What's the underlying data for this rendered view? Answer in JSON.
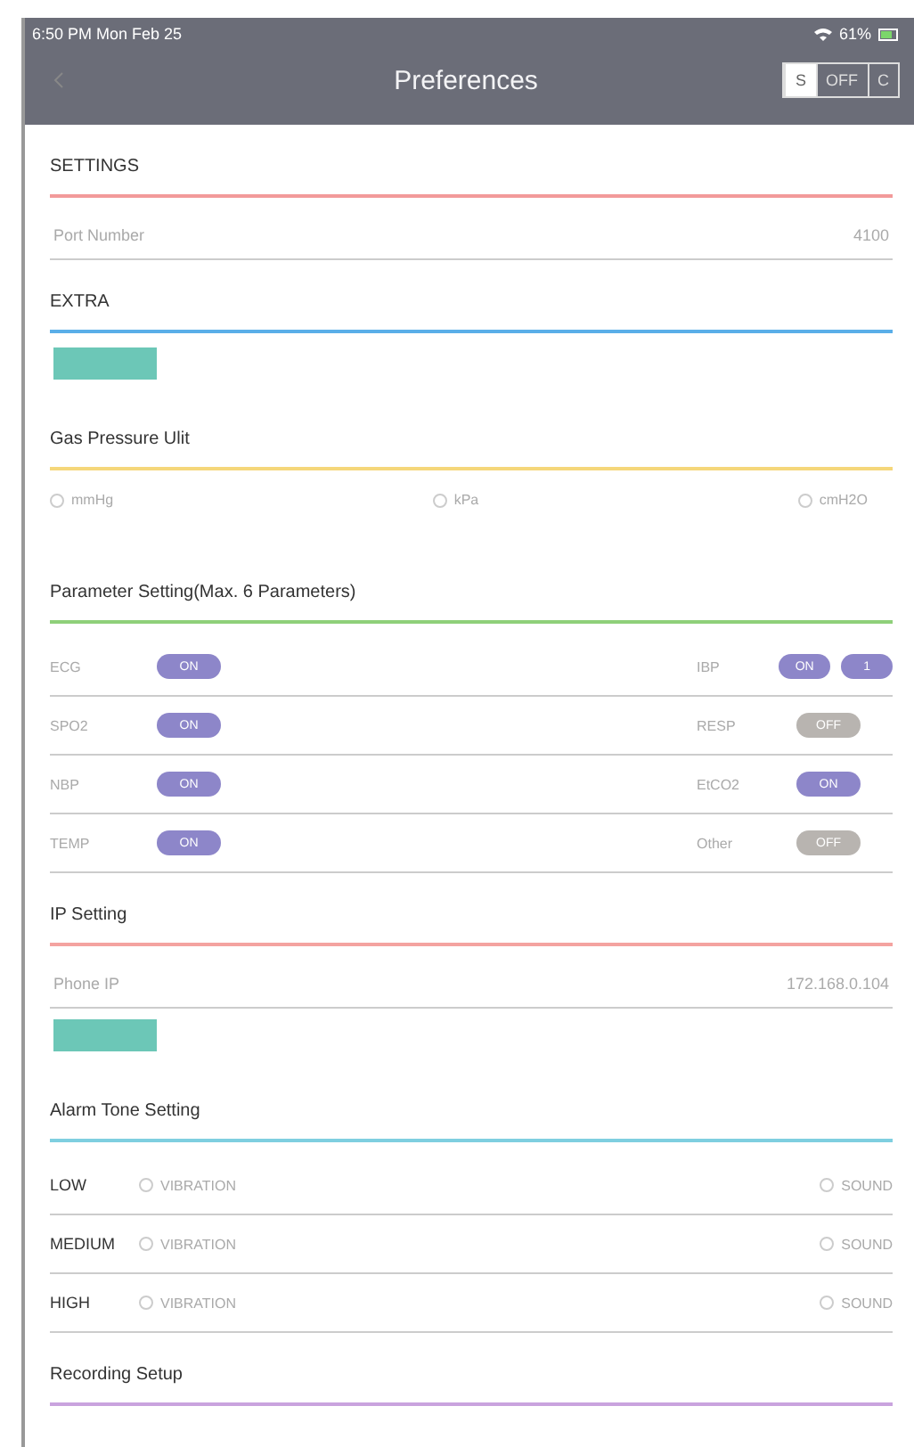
{
  "status_bar": {
    "time": "6:50 PM  Mon Feb 25",
    "battery": "61%"
  },
  "header": {
    "title": "Preferences",
    "segments": [
      {
        "label": "S",
        "selected": true
      },
      {
        "label": "OFF",
        "selected": false
      },
      {
        "label": "C",
        "selected": false
      }
    ]
  },
  "sections": [
    {
      "kind": "fields",
      "title": "SETTINGS",
      "color": "#f29a9a",
      "fields": [
        {
          "label": "Port Number",
          "value": "4100"
        }
      ]
    },
    {
      "kind": "button",
      "title": "EXTRA",
      "color": "#5aaee8"
    },
    {
      "kind": "radios",
      "title": "Gas Pressure Ulit",
      "color": "#f5d77a",
      "options": [
        {
          "label": "mmHg",
          "selected": false
        },
        {
          "label": "kPa",
          "selected": false
        },
        {
          "label": "cmH2O",
          "selected": false
        }
      ]
    },
    {
      "kind": "params",
      "title": "Parameter Setting(Max. 6 Parameters)",
      "color": "#8fd07a",
      "rows": [
        {
          "left": {
            "label": "ECG",
            "on": true,
            "text": "ON"
          },
          "right": {
            "label": "IBP",
            "on": true,
            "text": "ON",
            "extra": "1"
          }
        },
        {
          "left": {
            "label": "SPO2",
            "on": true,
            "text": "ON"
          },
          "right": {
            "label": "RESP",
            "on": false,
            "text": "OFF"
          }
        },
        {
          "left": {
            "label": "NBP",
            "on": true,
            "text": "ON"
          },
          "right": {
            "label": "EtCO2",
            "on": true,
            "text": "ON"
          }
        },
        {
          "left": {
            "label": "TEMP",
            "on": true,
            "text": "ON"
          },
          "right": {
            "label": "Other",
            "on": false,
            "text": "OFF"
          }
        }
      ]
    },
    {
      "kind": "fields_button",
      "title": "IP Setting",
      "color": "#f4a3a0",
      "fields": [
        {
          "label": "Phone IP",
          "value": "172.168.0.104"
        }
      ]
    },
    {
      "kind": "alarms",
      "title": "Alarm Tone Setting",
      "color": "#7fcfe0",
      "rows": [
        {
          "label": "LOW",
          "options": [
            {
              "label": "VIBRATION",
              "selected": false
            },
            {
              "label": "SOUND",
              "selected": false
            }
          ]
        },
        {
          "label": "MEDIUM",
          "options": [
            {
              "label": "VIBRATION",
              "selected": false
            },
            {
              "label": "SOUND",
              "selected": false
            }
          ]
        },
        {
          "label": "HIGH",
          "options": [
            {
              "label": "VIBRATION",
              "selected": false
            },
            {
              "label": "SOUND",
              "selected": false
            }
          ]
        }
      ]
    },
    {
      "kind": "title_only",
      "title": "Recording Setup",
      "color": "#c9a3de"
    }
  ]
}
